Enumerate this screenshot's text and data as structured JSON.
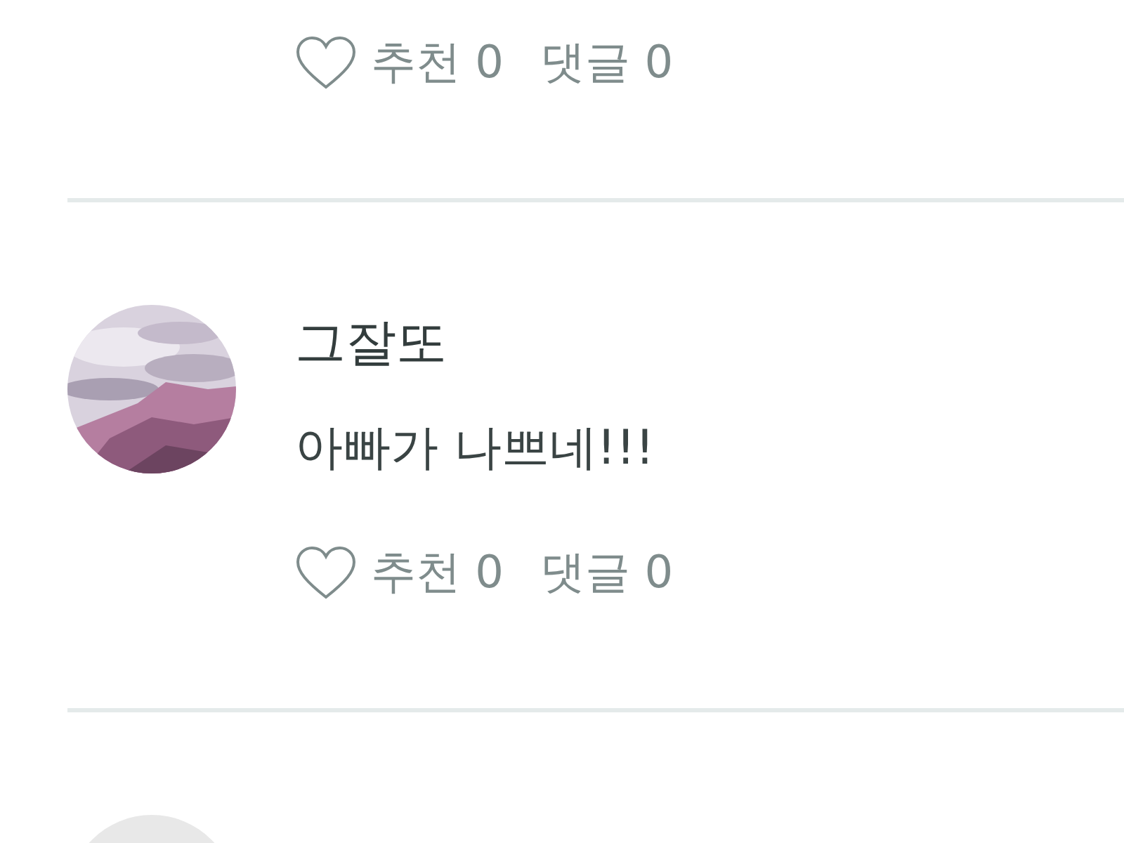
{
  "comments": [
    {
      "like_label": "추천 0",
      "comment_label": "댓글 0",
      "liked": false
    },
    {
      "author": "그잘또",
      "text": "아빠가 나쁘네!!!",
      "like_label": "추천 0",
      "comment_label": "댓글 0",
      "liked": false
    },
    {
      "avatar": {
        "kind": "default"
      }
    }
  ]
}
